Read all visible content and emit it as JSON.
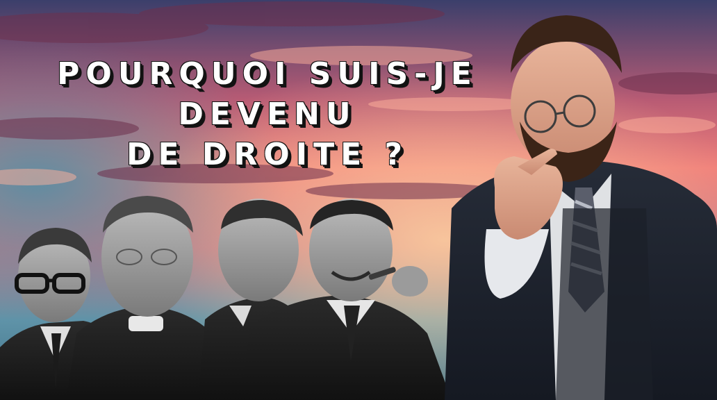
{
  "title": {
    "lines": [
      "POURQUOI SUIS-JE",
      "DEVENU",
      "DE DROITE ?"
    ]
  },
  "colors": {
    "sky_top": "#3b3f6b",
    "sky_pink": "#f07f7a",
    "sky_blue": "#5f93a8",
    "title_text": "#ffffff",
    "title_shadow": "#121212"
  }
}
